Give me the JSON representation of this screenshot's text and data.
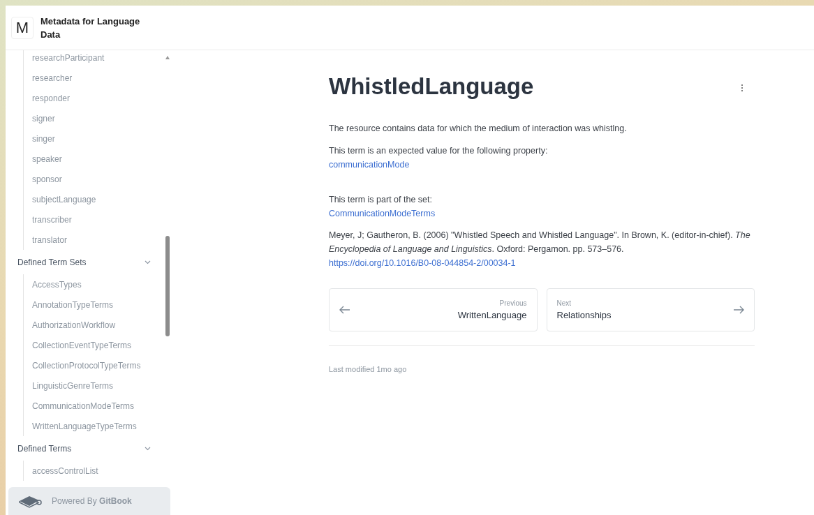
{
  "header": {
    "logo_letter": "M",
    "title": "Metadata for Language Data"
  },
  "sidebar": {
    "groups": [
      {
        "items": [
          "researchParticipant",
          "researcher",
          "responder",
          "signer",
          "singer",
          "speaker",
          "sponsor",
          "subjectLanguage",
          "transcriber",
          "translator"
        ]
      },
      {
        "heading": "Defined Term Sets",
        "expanded": true,
        "items": [
          "AccessTypes",
          "AnnotationTypeTerms",
          "AuthorizationWorkflow",
          "CollectionEventTypeTerms",
          "CollectionProtocolTypeTerms",
          "LinguisticGenreTerms",
          "CommunicationModeTerms",
          "WrittenLanguageTypeTerms"
        ]
      },
      {
        "heading": "Defined Terms",
        "expanded": true,
        "items": [
          "accessControlList"
        ]
      }
    ],
    "footer": "Powered By **GitBook**"
  },
  "page": {
    "title": "WhistledLanguage",
    "description": "The resource contains data for which the medium of interaction was whistlng.",
    "property_intro": "This term is an expected value for the following property:",
    "property_link": "communicationMode",
    "set_intro": "This term is part of the set:",
    "set_link": "CommunicationModeTerms",
    "citation": "Meyer, J; Gautheron, B. (2006) \"Whistled Speech and Whistled Language\". In Brown, K. (editor-in-chief).  *The Encyclopedia of Language and Linguistics*. Oxford: Pergamon. pp. 573–576.",
    "citation_link": "https://doi.org/10.1016/B0-08-044854-2/00034-1",
    "previous": {
      "label": "Previous",
      "title": "WrittenLanguage"
    },
    "next": {
      "label": "Next",
      "title": "Relationships"
    },
    "last_modified": "Last modified 1mo ago"
  }
}
